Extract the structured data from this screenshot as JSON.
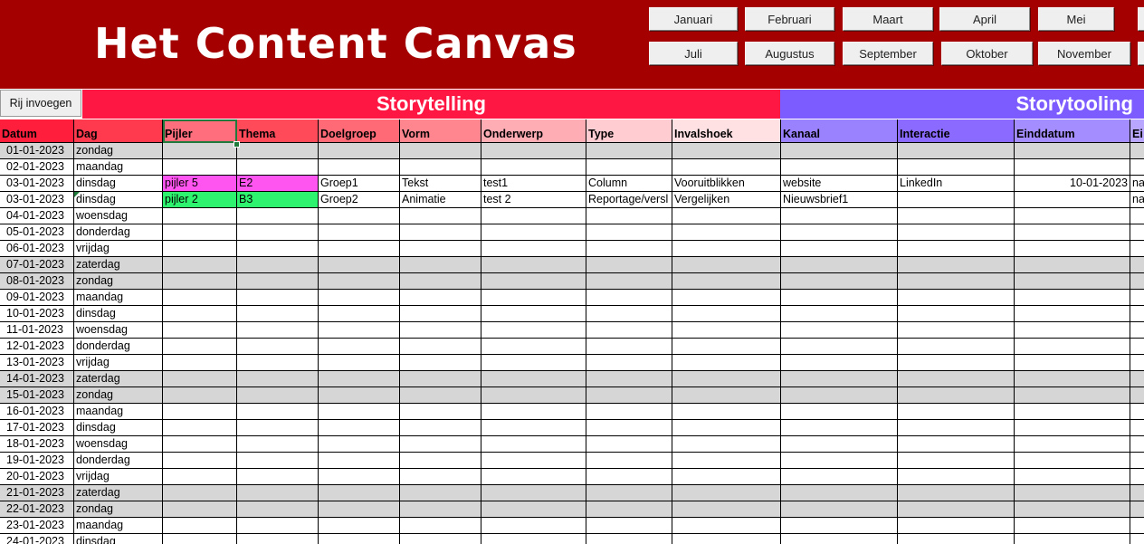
{
  "app": {
    "title": "Het Content Canvas"
  },
  "months": {
    "row1": [
      "Januari",
      "Februari",
      "Maart",
      "April",
      "Mei"
    ],
    "row2": [
      "Juli",
      "Augustus",
      "September",
      "Oktober",
      "November"
    ]
  },
  "toolbar": {
    "insert_row_label": "Rij invoegen"
  },
  "sections": {
    "storytelling": "Storytelling",
    "storytooling": "Storytooling"
  },
  "colors": {
    "banner": "#a50000",
    "storytelling_bar": "#ff1744",
    "storytooling_bar": "#7c5cff",
    "weekend_row": "#d6d6d6",
    "pijler_pink": "#ff55f0",
    "pijler_green": "#2ef36e"
  },
  "columns": [
    {
      "key": "datum",
      "label": "Datum",
      "color": "#ff1f3c"
    },
    {
      "key": "dag",
      "label": "Dag",
      "color": "#ff3a4e"
    },
    {
      "key": "pijler",
      "label": "Pijler",
      "color": "#ff6e7d"
    },
    {
      "key": "thema",
      "label": "Thema",
      "color": "#ff4a5a"
    },
    {
      "key": "doelgroep",
      "label": "Doelgroep",
      "color": "#ff6a76"
    },
    {
      "key": "vorm",
      "label": "Vorm",
      "color": "#ff858f"
    },
    {
      "key": "onderwerp",
      "label": "Onderwerp",
      "color": "#ffadb5"
    },
    {
      "key": "type",
      "label": "Type",
      "color": "#ffccd1"
    },
    {
      "key": "invalshoek",
      "label": "Invalshoek",
      "color": "#ffe1e4"
    },
    {
      "key": "kanaal",
      "label": "Kanaal",
      "color": "#9a82ff"
    },
    {
      "key": "interactie",
      "label": "Interactie",
      "color": "#8b6bff"
    },
    {
      "key": "einddatum",
      "label": "Einddatum",
      "color": "#a48dff"
    },
    {
      "key": "eigenaar",
      "label": "Ei",
      "color": "#b9a6ff"
    }
  ],
  "rows": [
    {
      "datum": "01-01-2023",
      "dag": "zondag",
      "weekend": true
    },
    {
      "datum": "02-01-2023",
      "dag": "maandag"
    },
    {
      "datum": "03-01-2023",
      "dag": "dinsdag",
      "pijler": "pijler 5",
      "thema": "E2",
      "doelgroep": "Groep1",
      "vorm": "Tekst",
      "onderwerp": "test1",
      "type": "Column",
      "invalshoek": "Vooruitblikken",
      "kanaal": "website",
      "interactie": "LinkedIn",
      "einddatum": "10-01-2023",
      "eigenaar": "na",
      "fill": "pink"
    },
    {
      "datum": "03-01-2023",
      "dag": "dinsdag",
      "pijler": "pijler 2",
      "thema": "B3",
      "doelgroep": "Groep2",
      "vorm": "Animatie",
      "onderwerp": "test 2",
      "type": "Reportage/versl",
      "invalshoek": "Vergelijken",
      "kanaal": "Nieuwsbrief1",
      "eigenaar": "na",
      "fill": "green",
      "flag": true
    },
    {
      "datum": "04-01-2023",
      "dag": "woensdag"
    },
    {
      "datum": "05-01-2023",
      "dag": "donderdag"
    },
    {
      "datum": "06-01-2023",
      "dag": "vrijdag"
    },
    {
      "datum": "07-01-2023",
      "dag": "zaterdag",
      "weekend": true
    },
    {
      "datum": "08-01-2023",
      "dag": "zondag",
      "weekend": true
    },
    {
      "datum": "09-01-2023",
      "dag": "maandag"
    },
    {
      "datum": "10-01-2023",
      "dag": "dinsdag"
    },
    {
      "datum": "11-01-2023",
      "dag": "woensdag"
    },
    {
      "datum": "12-01-2023",
      "dag": "donderdag"
    },
    {
      "datum": "13-01-2023",
      "dag": "vrijdag"
    },
    {
      "datum": "14-01-2023",
      "dag": "zaterdag",
      "weekend": true
    },
    {
      "datum": "15-01-2023",
      "dag": "zondag",
      "weekend": true
    },
    {
      "datum": "16-01-2023",
      "dag": "maandag"
    },
    {
      "datum": "17-01-2023",
      "dag": "dinsdag"
    },
    {
      "datum": "18-01-2023",
      "dag": "woensdag"
    },
    {
      "datum": "19-01-2023",
      "dag": "donderdag"
    },
    {
      "datum": "20-01-2023",
      "dag": "vrijdag"
    },
    {
      "datum": "21-01-2023",
      "dag": "zaterdag",
      "weekend": true
    },
    {
      "datum": "22-01-2023",
      "dag": "zondag",
      "weekend": true
    },
    {
      "datum": "23-01-2023",
      "dag": "maandag"
    },
    {
      "datum": "24-01-2023",
      "dag": "dinsdag"
    }
  ]
}
